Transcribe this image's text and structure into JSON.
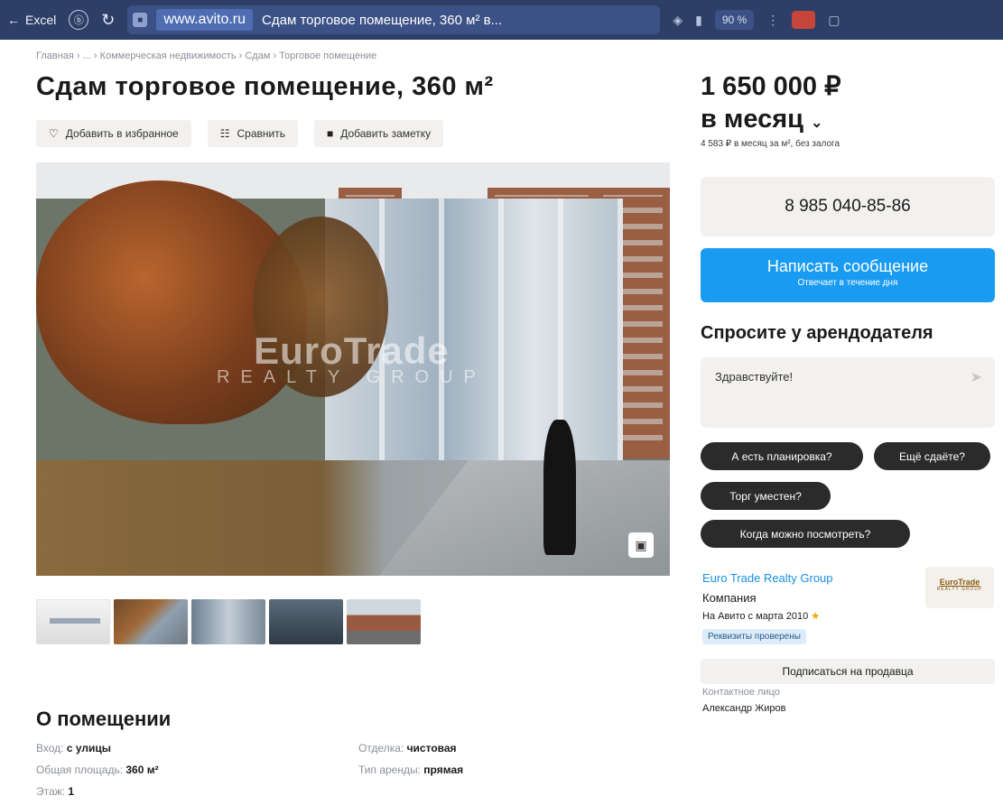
{
  "browser": {
    "back_label": "Excel",
    "url": "www.avito.ru",
    "tab_title": "Сдам торговое помещение, 360 м² в...",
    "zoom": "90 %"
  },
  "breadcrumb": "Главная › ... › Коммерческая недвижимость › Сдам › Торговое помещение",
  "title": "Сдам торговое помещение, 360 м²",
  "actions": {
    "favorite": "Добавить в избранное",
    "compare": "Сравнить",
    "note": "Добавить заметку"
  },
  "photo": {
    "watermark_main": "EuroTrade",
    "watermark_sub": "REALTY GROUP"
  },
  "price": {
    "amount": "1 650 000 ₽",
    "period": "в месяц",
    "note": "4 583 ₽ в месяц за м², без залога"
  },
  "contact": {
    "phone": "8 985 040-85-86",
    "message_label": "Написать сообщение",
    "message_sub": "Отвечает в течение дня"
  },
  "ask": {
    "title": "Спросите у арендодателя",
    "input_value": "Здравствуйте!",
    "chips": [
      "А есть планировка?",
      "Ещё сдаёте?",
      "Торг уместен?",
      "Когда можно посмотреть?"
    ]
  },
  "seller": {
    "name": "Euro Trade Realty Group",
    "type": "Компания",
    "since": "На Авито с марта 2010",
    "badge": "Реквизиты проверены",
    "logo_main": "EuroTrade",
    "logo_sub": "REALTY GROUP",
    "subscribe": "Подписаться на продавца",
    "contact_label": "Контактное лицо",
    "contact_name": "Александр Жиров"
  },
  "about": {
    "title": "О помещении",
    "params": [
      {
        "key": "Вход:",
        "value": "с улицы"
      },
      {
        "key": "Общая площадь:",
        "value": "360 м²"
      },
      {
        "key": "Этаж:",
        "value": "1"
      },
      {
        "key": "Отделка:",
        "value": "чистовая"
      },
      {
        "key": "Тип аренды:",
        "value": "прямая"
      }
    ]
  },
  "icons": {
    "favorite": "heart-icon",
    "compare": "compare-icon",
    "note": "note-icon",
    "send": "send-icon",
    "gallery": "gallery-icon",
    "achievement": "medal-icon"
  },
  "colors": {
    "accent": "#1a9bf2",
    "browser": "#2d3f66",
    "chip": "#2b2b2b",
    "link": "#1a8fe3"
  }
}
